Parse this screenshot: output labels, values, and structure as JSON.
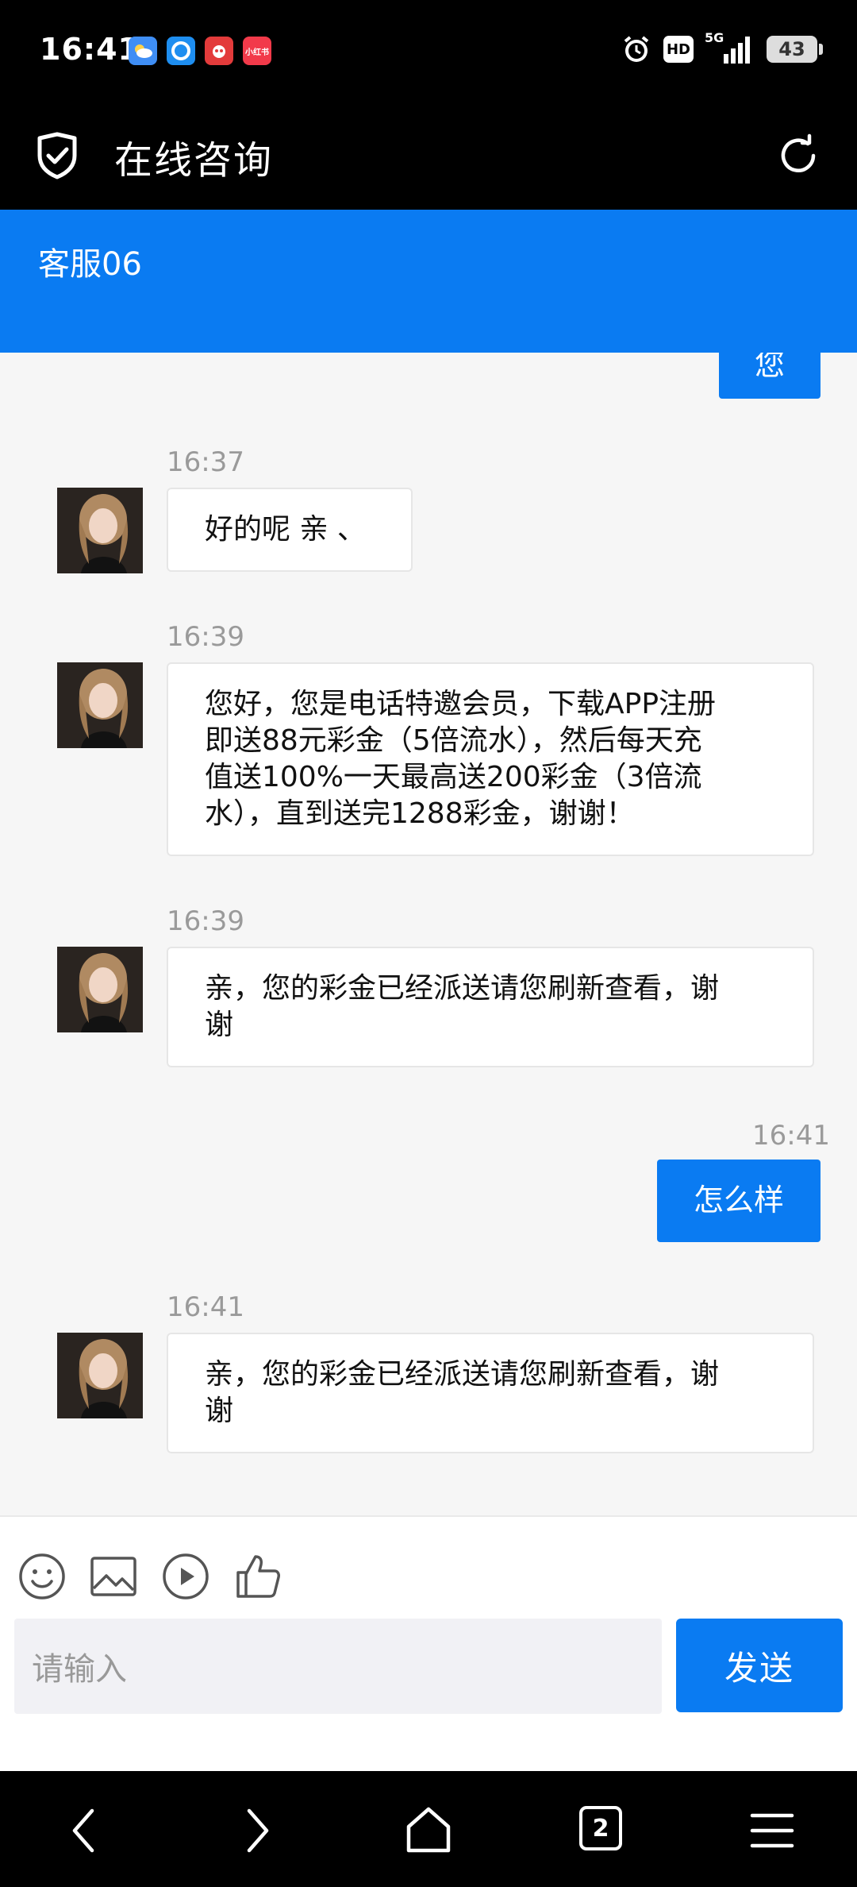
{
  "status_bar": {
    "time": "16:41",
    "notifications": [
      "weather-icon",
      "browser-icon",
      "shopping-icon",
      "xiaohongshu-icon"
    ],
    "notification_labels": [
      "",
      "",
      "",
      "小红书"
    ],
    "hd": "HD",
    "network": "5G",
    "battery": "43"
  },
  "header": {
    "title": "在线咨询"
  },
  "agent": {
    "name": "客服06"
  },
  "messages": [
    {
      "side": "out",
      "time": "",
      "text": "您"
    },
    {
      "side": "in",
      "time": "16:37",
      "text": "好的呢 亲 、"
    },
    {
      "side": "in",
      "time": "16:39",
      "lines": [
        "您好，您是电话特邀会员，下载APP注册",
        "即送88元彩金（5倍流水），然后每天充",
        "值送100%一天最高送200彩金（3倍流",
        "水），直到送完1288彩金，谢谢！"
      ]
    },
    {
      "side": "in",
      "time": "16:39",
      "lines": [
        "亲，您的彩金已经派送请您刷新查看，谢",
        "谢"
      ]
    },
    {
      "side": "out",
      "time": "16:41",
      "text": "怎么样"
    },
    {
      "side": "in",
      "time": "16:41",
      "lines": [
        "亲，您的彩金已经派送请您刷新查看，谢",
        "谢"
      ]
    }
  ],
  "input": {
    "placeholder": "请输入",
    "send_label": "发送"
  },
  "toolbar": {
    "icons": [
      "emoji-icon",
      "image-icon",
      "video-icon",
      "like-icon"
    ]
  },
  "nav": {
    "tab_count": "2"
  },
  "colors": {
    "accent": "#0a7bf2",
    "background": "#f6f6f6",
    "timestamp": "#9a9a9a"
  }
}
